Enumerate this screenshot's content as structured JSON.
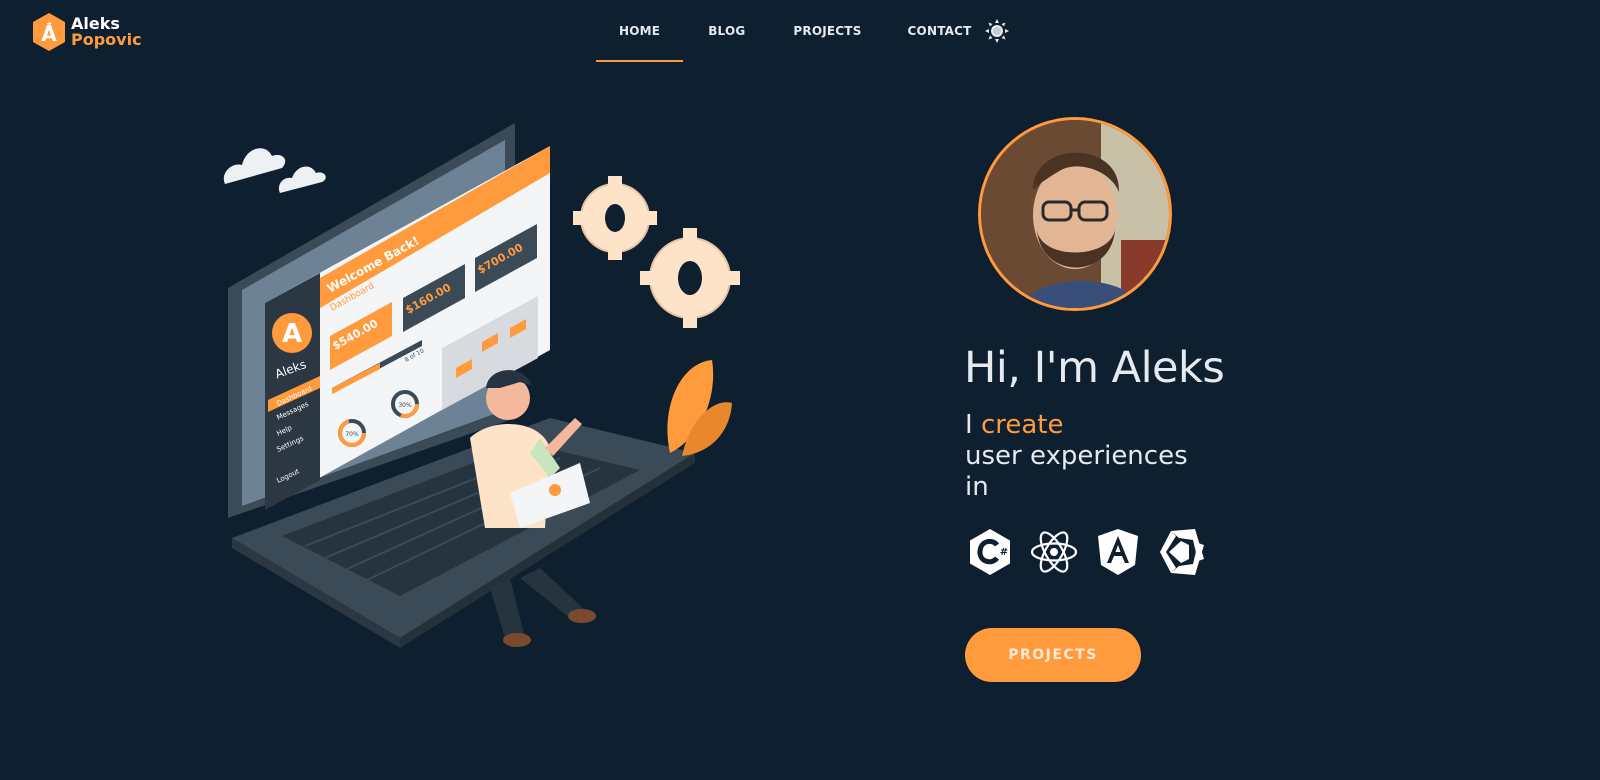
{
  "header": {
    "logo": {
      "mark_glyph": "#",
      "mark_letter": "A",
      "first_name": "Aleks",
      "last_name": "Popovic"
    },
    "nav": [
      {
        "label": "HOME",
        "active": true
      },
      {
        "label": "BLOG",
        "active": false
      },
      {
        "label": "PROJECTS",
        "active": false
      },
      {
        "label": "CONTACT",
        "active": false
      }
    ],
    "theme_toggle_icon": "sun-icon"
  },
  "illustration": {
    "screen": {
      "welcome": "Welcome Back!",
      "dashboard_label": "Dashboard",
      "brand_letter": "A",
      "brand_name": "Aleks",
      "amounts": [
        "$540.00",
        "$160.00",
        "$700.00"
      ],
      "progress_labels": [
        "8 of 10",
        "70%",
        "30%"
      ],
      "menu": [
        "Dashboard",
        "Messages",
        "Help",
        "Settings",
        "Logout"
      ]
    }
  },
  "hero": {
    "greeting": "Hi, I'm Aleks",
    "tagline_prefix": "I ",
    "tagline_accent": "create",
    "tagline_line2": "user experiences",
    "tagline_line3": "in",
    "tech_icons": [
      "csharp-icon",
      "react-icon",
      "angular-icon",
      "unity-icon"
    ],
    "cta_label": "PROJECTS"
  },
  "colors": {
    "background": "#0e1f2f",
    "accent": "#ff9a3d",
    "text": "#e6e9ee"
  }
}
